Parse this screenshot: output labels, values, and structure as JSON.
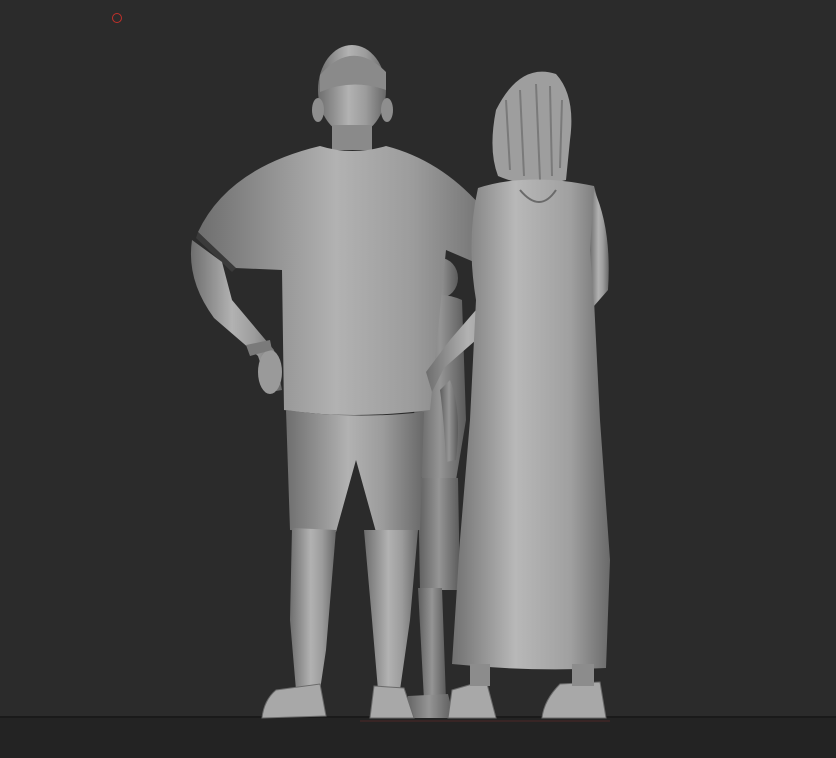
{
  "viewport": {
    "background": "#2b2b2b",
    "model_color": "#9a9a9a",
    "pivot_marker_color": "#c0302a"
  },
  "scene": {
    "figures": [
      {
        "name": "man",
        "icon": "man-figure"
      },
      {
        "name": "child",
        "icon": "child-figure"
      },
      {
        "name": "woman",
        "icon": "woman-figure"
      }
    ]
  }
}
